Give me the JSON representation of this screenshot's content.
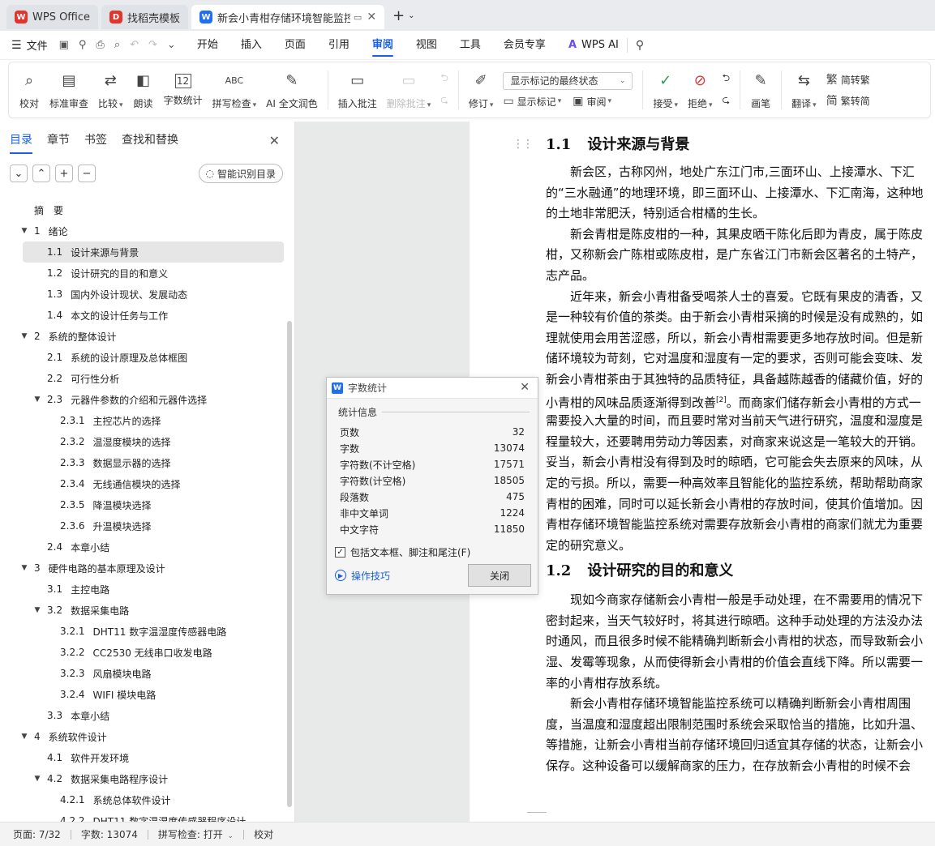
{
  "tabs": [
    {
      "label": "WPS Office",
      "logo": "W"
    },
    {
      "label": "找稻壳模板",
      "logo": "D"
    },
    {
      "label": "新会小青柑存储环境智能监控",
      "logo": "W"
    }
  ],
  "menubar": {
    "file_label": "文件",
    "items": [
      "开始",
      "插入",
      "页面",
      "引用",
      "审阅",
      "视图",
      "工具",
      "会员专享"
    ],
    "ai_label": "WPS AI",
    "ai_logo": "A"
  },
  "ribbon": {
    "proofread": "校对",
    "standard_review": "标准审查",
    "compare": "比较",
    "read_aloud": "朗读",
    "word_count": "字数统计",
    "spell_check": "拼写检查",
    "ai_polish": "AI 全文润色",
    "insert_comment": "插入批注",
    "delete_comment": "删除批注",
    "revise": "修订",
    "markup_dropdown": "显示标记的最终状态",
    "show_markup": "显示标记",
    "review": "审阅",
    "accept": "接受",
    "reject": "拒绝",
    "pen": "画笔",
    "translate": "翻译",
    "to_traditional": "简转繁",
    "to_simplified": "繁转简",
    "word_count_icon_text": "12",
    "spell_icon_text": "ABC"
  },
  "nav": {
    "tabs": [
      "目录",
      "章节",
      "书签",
      "查找和替换"
    ],
    "smart_toc": "智能识别目录",
    "toc": [
      {
        "num": "",
        "text": "摘　要",
        "level": 0,
        "arrow": false
      },
      {
        "num": "1",
        "text": "绪论",
        "level": 0,
        "arrow": true
      },
      {
        "num": "1.1",
        "text": "设计来源与背景",
        "level": 1,
        "arrow": false,
        "selected": true
      },
      {
        "num": "1.2",
        "text": "设计研究的目的和意义",
        "level": 1,
        "arrow": false
      },
      {
        "num": "1.3",
        "text": "国内外设计现状、发展动态",
        "level": 1,
        "arrow": false
      },
      {
        "num": "1.4",
        "text": "本文的设计任务与工作",
        "level": 1,
        "arrow": false
      },
      {
        "num": "2",
        "text": "系统的整体设计",
        "level": 0,
        "arrow": true
      },
      {
        "num": "2.1",
        "text": "系统的设计原理及总体框图",
        "level": 1,
        "arrow": false
      },
      {
        "num": "2.2",
        "text": "可行性分析",
        "level": 1,
        "arrow": false
      },
      {
        "num": "2.3",
        "text": "元器件参数的介绍和元器件选择",
        "level": 1,
        "arrow": true
      },
      {
        "num": "2.3.1",
        "text": "主控芯片的选择",
        "level": 2,
        "arrow": false
      },
      {
        "num": "2.3.2",
        "text": "温湿度模块的选择",
        "level": 2,
        "arrow": false
      },
      {
        "num": "2.3.3",
        "text": "数据显示器的选择",
        "level": 2,
        "arrow": false
      },
      {
        "num": "2.3.4",
        "text": "无线通信模块的选择",
        "level": 2,
        "arrow": false
      },
      {
        "num": "2.3.5",
        "text": "降温模块选择",
        "level": 2,
        "arrow": false
      },
      {
        "num": "2.3.6",
        "text": "升温模块选择",
        "level": 2,
        "arrow": false
      },
      {
        "num": "2.4",
        "text": "本章小结",
        "level": 1,
        "arrow": false
      },
      {
        "num": "3",
        "text": "硬件电路的基本原理及设计",
        "level": 0,
        "arrow": true
      },
      {
        "num": "3.1",
        "text": "主控电路",
        "level": 1,
        "arrow": false
      },
      {
        "num": "3.2",
        "text": "数据采集电路",
        "level": 1,
        "arrow": true
      },
      {
        "num": "3.2.1",
        "text": "DHT11 数字温湿度传感器电路",
        "level": 2,
        "arrow": false
      },
      {
        "num": "3.2.2",
        "text": "CC2530 无线串口收发电路",
        "level": 2,
        "arrow": false
      },
      {
        "num": "3.2.3",
        "text": "风扇模块电路",
        "level": 2,
        "arrow": false
      },
      {
        "num": "3.2.4",
        "text": "WIFI 模块电路",
        "level": 2,
        "arrow": false
      },
      {
        "num": "3.3",
        "text": "本章小结",
        "level": 1,
        "arrow": false
      },
      {
        "num": "4",
        "text": "系统软件设计",
        "level": 0,
        "arrow": true
      },
      {
        "num": "4.1",
        "text": "软件开发环境",
        "level": 1,
        "arrow": false
      },
      {
        "num": "4.2",
        "text": "数据采集电路程序设计",
        "level": 1,
        "arrow": true
      },
      {
        "num": "4.2.1",
        "text": "系统总体软件设计",
        "level": 2,
        "arrow": false
      },
      {
        "num": "4.2.2",
        "text": "DHT11 数字温湿度传感器程序设计",
        "level": 2,
        "arrow": false
      }
    ]
  },
  "doc": {
    "h1_num": "1.1",
    "h1_text": "设计来源与背景",
    "lines_a": [
      {
        "t": "新会区，古称冈州，地处广东江门市,三面环山、上接潭水、下汇",
        "i": true
      },
      {
        "t": "的“三水融通”的地理环境，即三面环山、上接潭水、下汇南海，这种地",
        "i": false
      },
      {
        "t": "的土地非常肥沃，特别适合柑橘的生长。",
        "i": false
      },
      {
        "t": "新会青柑是陈皮柑的一种，其果皮晒干陈化后即为青皮，属于陈皮",
        "i": true
      },
      {
        "t": "柑，又称新会广陈柑或陈皮柑，是广东省江门市新会区著名的土特产，",
        "i": false
      },
      {
        "t": "志产品。",
        "i": false
      },
      {
        "t": "近年来，新会小青柑备受喝茶人士的喜爱。它既有果皮的清香，又",
        "i": true
      },
      {
        "t": "是一种较有价值的茶类。由于新会小青柑采摘的时候是没有成熟的，如",
        "i": false
      },
      {
        "t": "理就使用会用苦涩感，所以，新会小青柑需要更多地存放时间。但是新",
        "i": false
      },
      {
        "t": "储环境较为苛刻，它对温度和湿度有一定的要求，否则可能会变味、发",
        "i": false
      },
      {
        "t": "新会小青柑茶由于其独特的品质特征，具备越陈越香的储藏价值，好的",
        "i": false
      },
      {
        "t": "小青柑的风味品质逐渐得到改善",
        "i": false,
        "sup": "[2]",
        "after": "。而商家们储存新会小青柑的方式一"
      },
      {
        "t": "需要投入大量的时间，而且要时常对当前天气进行研究，温度和湿度是",
        "i": false
      },
      {
        "t": "程量较大，还要聘用劳动力等因素，对商家来说这是一笔较大的开销。",
        "i": false
      },
      {
        "t": "妥当，新会小青柑没有得到及时的晾晒，它可能会失去原来的风味，从",
        "i": false
      },
      {
        "t": "定的亏损。所以，需要一种高效率且智能化的监控系统，帮助帮助商家",
        "i": false
      },
      {
        "t": "青柑的困难，同时可以延长新会小青柑的存放时间，使其价值增加。因",
        "i": false
      },
      {
        "t": "青柑存储环境智能监控系统对需要存放新会小青柑的商家们就尤为重要",
        "i": false
      },
      {
        "t": "定的研究意义。",
        "i": false
      }
    ],
    "h2_num": "1.2",
    "h2_text": "设计研究的目的和意义",
    "lines_b": [
      {
        "t": "现如今商家存储新会小青柑一般是手动处理，在不需要用的情况下",
        "i": true
      },
      {
        "t": "密封起来，当天气较好时，将其进行晾晒。这种手动处理的方法没办法",
        "i": false
      },
      {
        "t": "时通风，而且很多时候不能精确判断新会小青柑的状态，而导致新会小",
        "i": false
      },
      {
        "t": "湿、发霉等现象，从而使得新会小青柑的价值会直线下降。所以需要一",
        "i": false
      },
      {
        "t": "率的小青柑存放系统。",
        "i": false
      },
      {
        "t": "新会小青柑存储环境智能监控系统可以精确判断新会小青柑周围",
        "i": true
      },
      {
        "t": "度，当温度和湿度超出限制范围时系统会采取恰当的措施，比如升温、",
        "i": false
      },
      {
        "t": "等措施，让新会小青柑当前存储环境回归适宜其存储的状态，让新会小",
        "i": false
      },
      {
        "t": "保存。这种设备可以缓解商家的压力，在存放新会小青柑的时候不会",
        "i": false
      }
    ]
  },
  "dialog": {
    "title": "字数统计",
    "section": "统计信息",
    "stats": [
      {
        "label": "页数",
        "value": "32"
      },
      {
        "label": "字数",
        "value": "13074"
      },
      {
        "label": "字符数(不计空格)",
        "value": "17571"
      },
      {
        "label": "字符数(计空格)",
        "value": "18505"
      },
      {
        "label": "段落数",
        "value": "475"
      },
      {
        "label": "非中文单词",
        "value": "1224"
      },
      {
        "label": "中文字符",
        "value": "11850"
      }
    ],
    "checkbox_label": "包括文本框、脚注和尾注(F)",
    "checkbox_checked": true,
    "tips": "操作技巧",
    "close": "关闭"
  },
  "statusbar": {
    "page": "页面: 7/32",
    "words": "字数: 13074",
    "spell": "拼写检查: 打开",
    "proof": "校对"
  },
  "colors": {
    "accent": "#1a5fe0",
    "wps_red": "#e1352d",
    "word_blue": "#1f6ff5"
  }
}
